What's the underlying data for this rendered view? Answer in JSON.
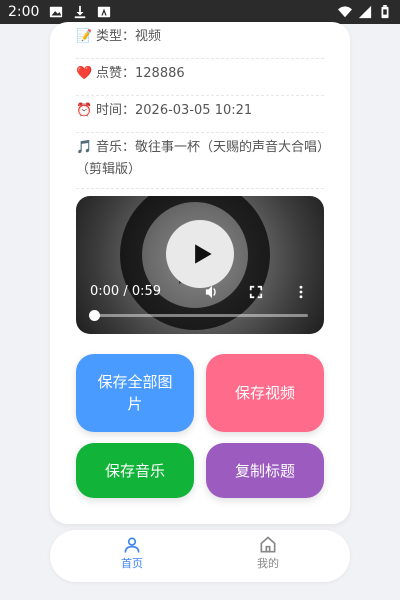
{
  "status_bar": {
    "time": "2:00",
    "icons": [
      "image-icon",
      "download-icon",
      "app-a-icon"
    ],
    "right_icons": [
      "wifi-icon",
      "signal-icon",
      "battery-icon"
    ]
  },
  "info": {
    "type": {
      "emoji": "📝",
      "label": "类型：",
      "value": "视频"
    },
    "likes": {
      "emoji": "❤️",
      "label": "点赞：",
      "value": "128886"
    },
    "time": {
      "emoji": "⏰",
      "label": "时间：",
      "value": "2026-03-05 10:21"
    },
    "music": {
      "emoji": "🎵",
      "label": "音乐：",
      "value": "敬往事一杯（天赐的声音大合唱）（剪辑版）"
    }
  },
  "video": {
    "time_display": "0:00 / 0:59",
    "progress": 0,
    "controls": [
      "play-icon",
      "volume-icon",
      "fullscreen-icon",
      "more-icon"
    ]
  },
  "buttons": {
    "save_all_images": "保存全部图片",
    "save_video": "保存视频",
    "save_music": "保存音乐",
    "copy_title": "复制标题"
  },
  "colors": {
    "save_all_images": "#4a9bff",
    "save_video": "#ff6b8b",
    "save_music": "#11b339",
    "copy_title": "#9b5bbf",
    "nav_active": "#3d86f2",
    "nav_inactive": "#888888"
  },
  "nav": {
    "home": "首页",
    "mine": "我的"
  }
}
